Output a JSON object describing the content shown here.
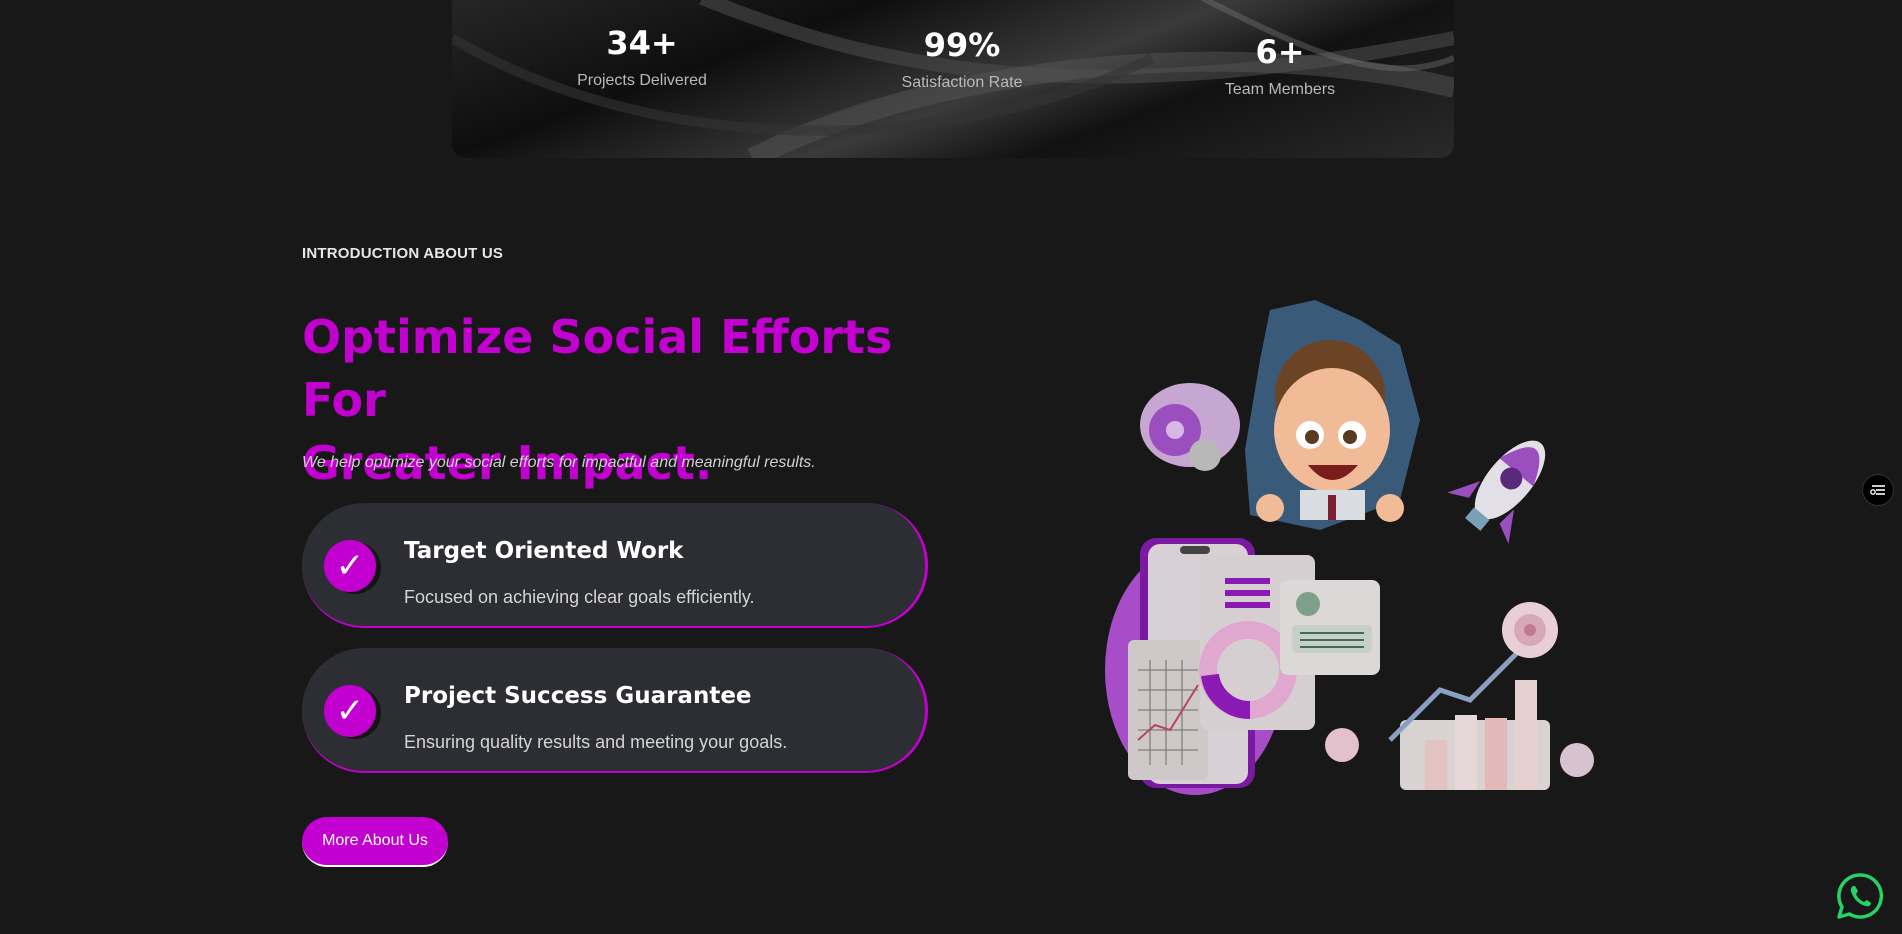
{
  "stats": [
    {
      "value": "34+",
      "label": "Projects Delivered"
    },
    {
      "value": "99%",
      "label": "Satisfaction Rate"
    },
    {
      "value": "6+",
      "label": "Team Members"
    }
  ],
  "about": {
    "eyebrow": "INTRODUCTION ABOUT US",
    "headline_line1": "Optimize Social Efforts For",
    "headline_line2": "Greater Impact.",
    "subtext": "We help optimize your social efforts for impactful and meaningful results.",
    "features": [
      {
        "title": "Target Oriented Work",
        "description": "Focused on achieving clear goals efficiently."
      },
      {
        "title": "Project Success Guarantee",
        "description": "Ensuring quality results and meeting your goals."
      }
    ],
    "cta_label": "More About Us"
  },
  "icons": {
    "check": "check-icon",
    "settings_toggle": "filter-toggle-icon",
    "whatsapp": "whatsapp-icon"
  },
  "colors": {
    "accent": "#c200cf",
    "background": "#181818",
    "card": "#2c2e33",
    "whatsapp": "#25d366"
  }
}
